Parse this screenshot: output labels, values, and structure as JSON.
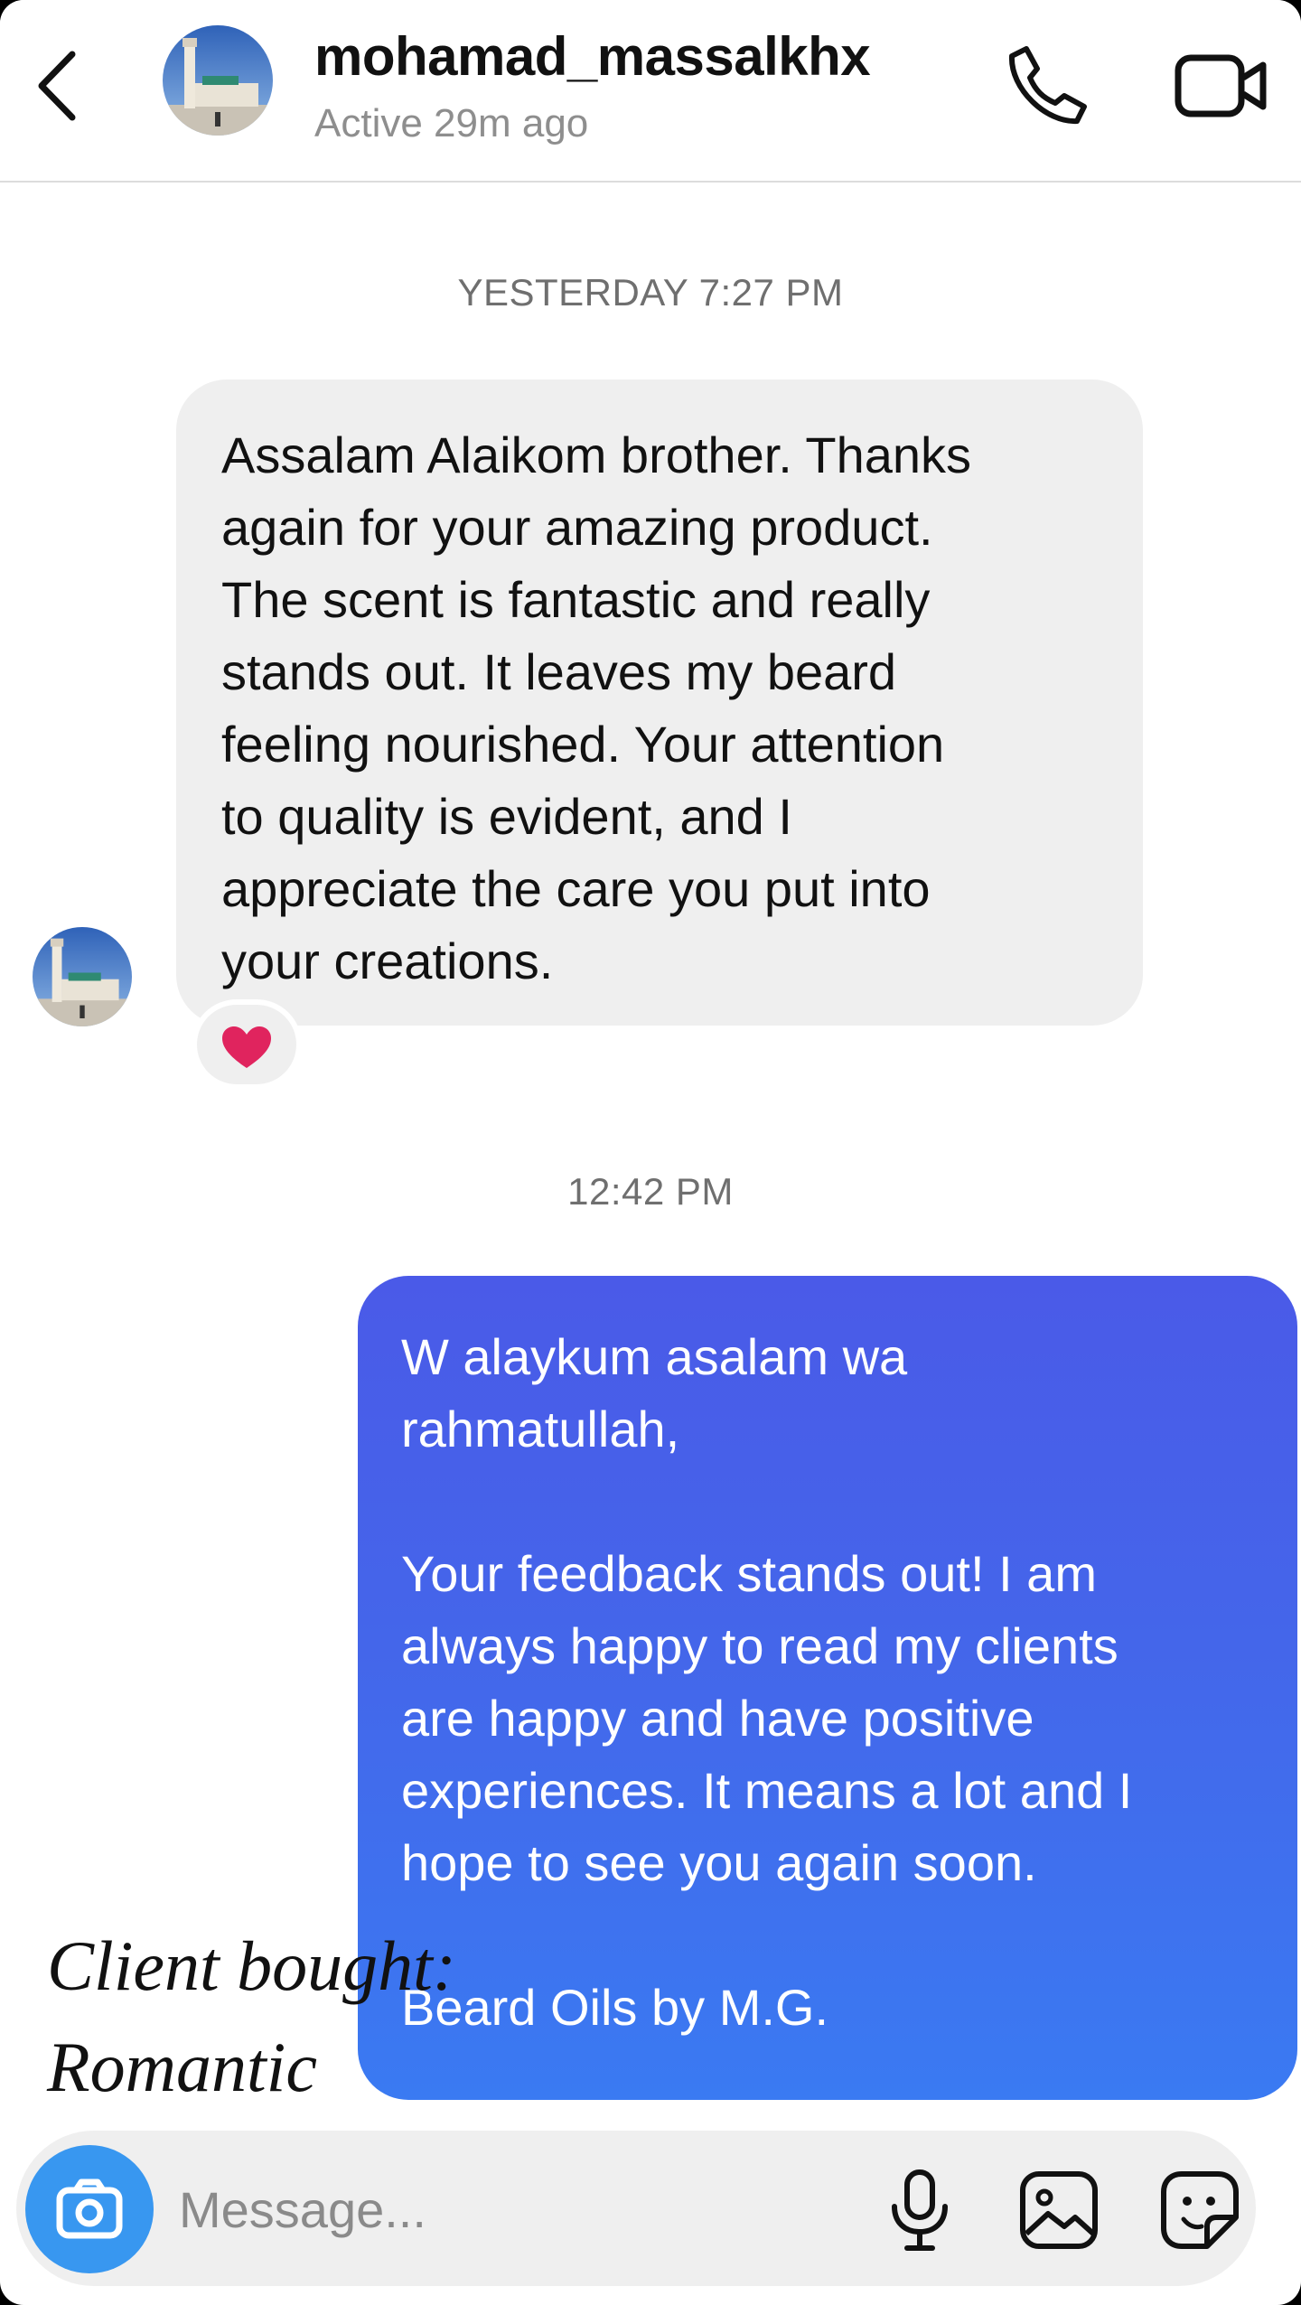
{
  "header": {
    "username": "mohamad_massalkhx",
    "status": "Active 29m ago",
    "icons": {
      "back": "chevron-left-icon",
      "call": "phone-icon",
      "video": "video-camera-icon"
    }
  },
  "conversation": {
    "timestamps": [
      "YESTERDAY 7:27 PM",
      "12:42 PM"
    ],
    "incoming": {
      "text": "Assalam Alaikom brother. Thanks\nagain for your amazing product.\nThe scent is fantastic and really\nstands out. It leaves my beard\nfeeling nourished. Your attention\nto quality is evident, and I\nappreciate the care you put into\nyour creations.",
      "reaction": "❤️"
    },
    "outgoing": {
      "text": "W alaykum asalam wa\nrahmatullah,\n\nYour feedback stands out! I am\nalways happy to read my clients\nare happy and have positive\nexperiences. It means a lot and I\nhope to see you again soon.\n\nBeard Oils by M.G."
    }
  },
  "overlay": {
    "text": "Client bought:\nRomantic"
  },
  "composer": {
    "placeholder": "Message...",
    "value": "",
    "icons": {
      "camera": "camera-icon",
      "mic": "microphone-icon",
      "gallery": "image-icon",
      "sticker": "sticker-icon"
    }
  },
  "colors": {
    "incoming_bubble": "#efefef",
    "outgoing_bubble_top": "#4a5ae8",
    "outgoing_bubble_bottom": "#3a7af2",
    "camera_button": "#3897f0",
    "reaction_heart": "#e0245e"
  }
}
